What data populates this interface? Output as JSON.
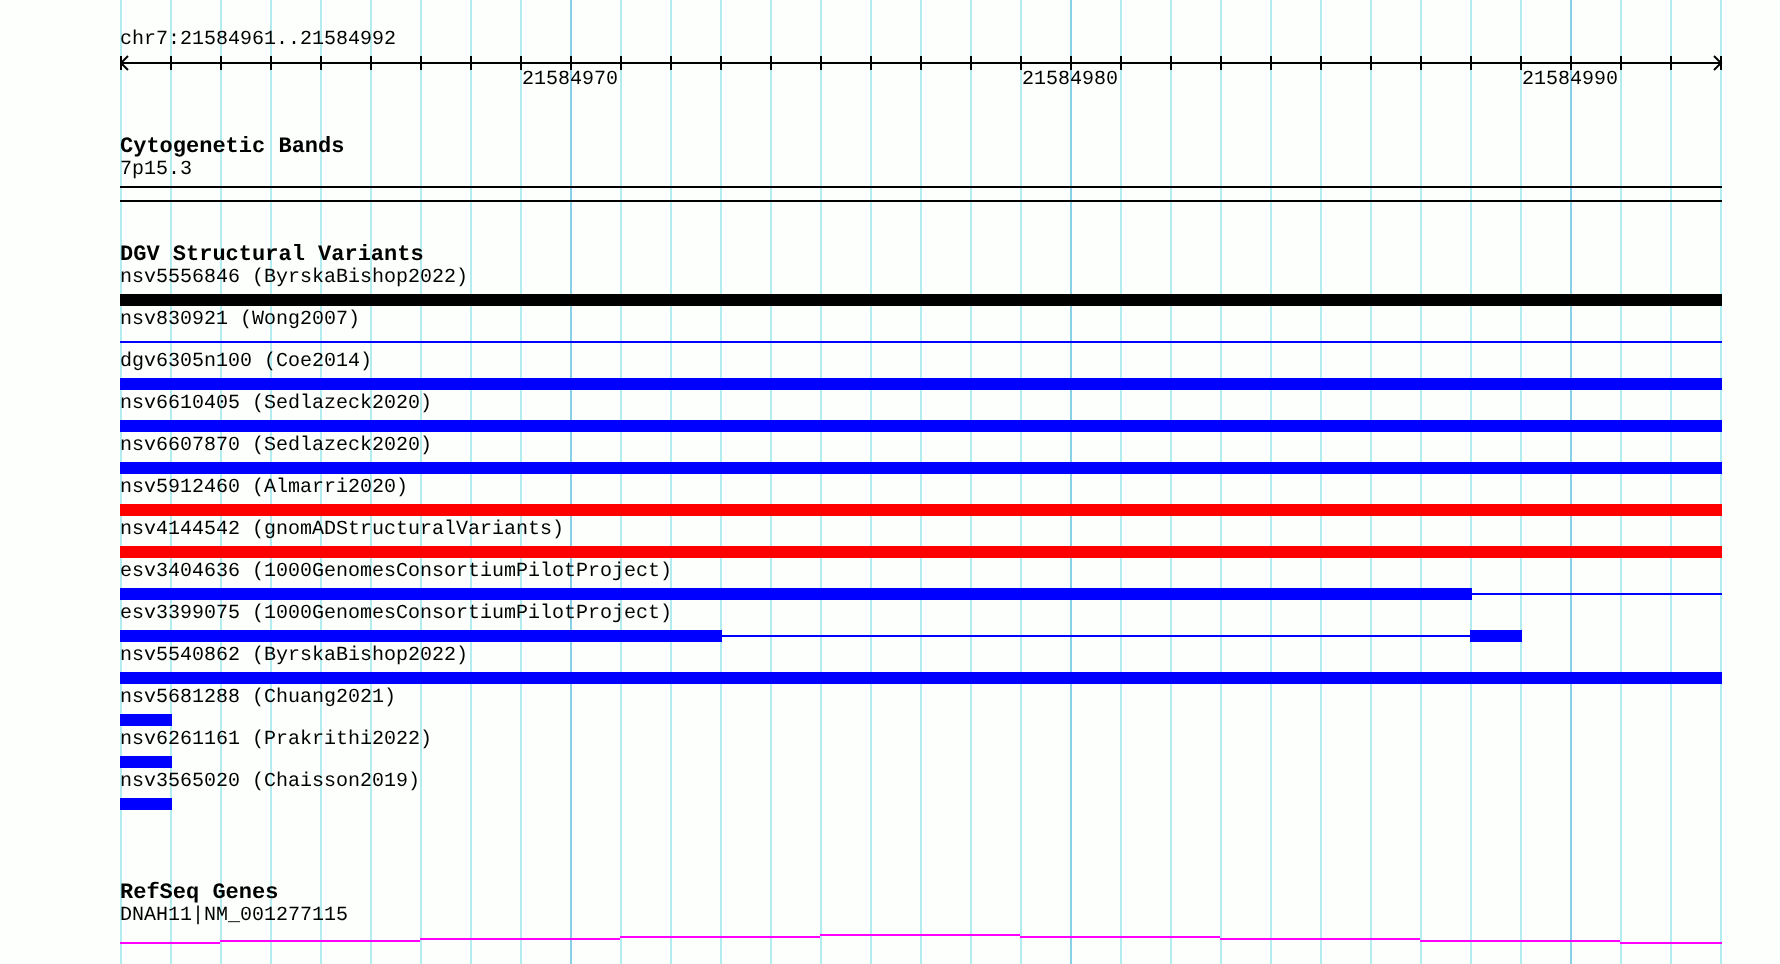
{
  "position": "chr7:21584961..21584992",
  "ruler": {
    "ticks": [
      "21584970",
      "21584980",
      "21584990"
    ]
  },
  "cytogenetic_bands": {
    "title": "Cytogenetic Bands",
    "band": "7p15.3"
  },
  "dgv": {
    "title": "DGV Structural Variants",
    "variants": [
      {
        "label": "nsv5556846 (ByrskaBishop2022)",
        "color": "#000000",
        "kind": "full-thick"
      },
      {
        "label": "nsv830921 (Wong2007)",
        "color": "#0000ff",
        "kind": "full-thin"
      },
      {
        "label": "dgv6305n100 (Coe2014)",
        "color": "#0000ff",
        "kind": "full-thick"
      },
      {
        "label": "nsv6610405 (Sedlazeck2020)",
        "color": "#0000ff",
        "kind": "full-thick"
      },
      {
        "label": "nsv6607870 (Sedlazeck2020)",
        "color": "#0000ff",
        "kind": "full-thick"
      },
      {
        "label": "nsv5912460 (Almarri2020)",
        "color": "#ff0000",
        "kind": "full-thick"
      },
      {
        "label": "nsv4144542 (gnomADStructuralVariants)",
        "color": "#ff0000",
        "kind": "full-thick"
      },
      {
        "label": "esv3404636 (1000GenomesConsortiumPilotProject)",
        "color": "#0000ff",
        "kind": "thick-thin"
      },
      {
        "label": "esv3399075 (1000GenomesConsortiumPilotProject)",
        "color": "#0000ff",
        "kind": "split"
      },
      {
        "label": "nsv5540862 (ByrskaBishop2022)",
        "color": "#0000ff",
        "kind": "full-thick"
      },
      {
        "label": "nsv5681288 (Chuang2021)",
        "color": "#0000ff",
        "kind": "short"
      },
      {
        "label": "nsv6261161 (Prakrithi2022)",
        "color": "#0000ff",
        "kind": "short"
      },
      {
        "label": "nsv3565020 (Chaisson2019)",
        "color": "#0000ff",
        "kind": "short"
      }
    ]
  },
  "refseq": {
    "title": "RefSeq Genes",
    "gene": "DNAH11|NM_001277115"
  }
}
